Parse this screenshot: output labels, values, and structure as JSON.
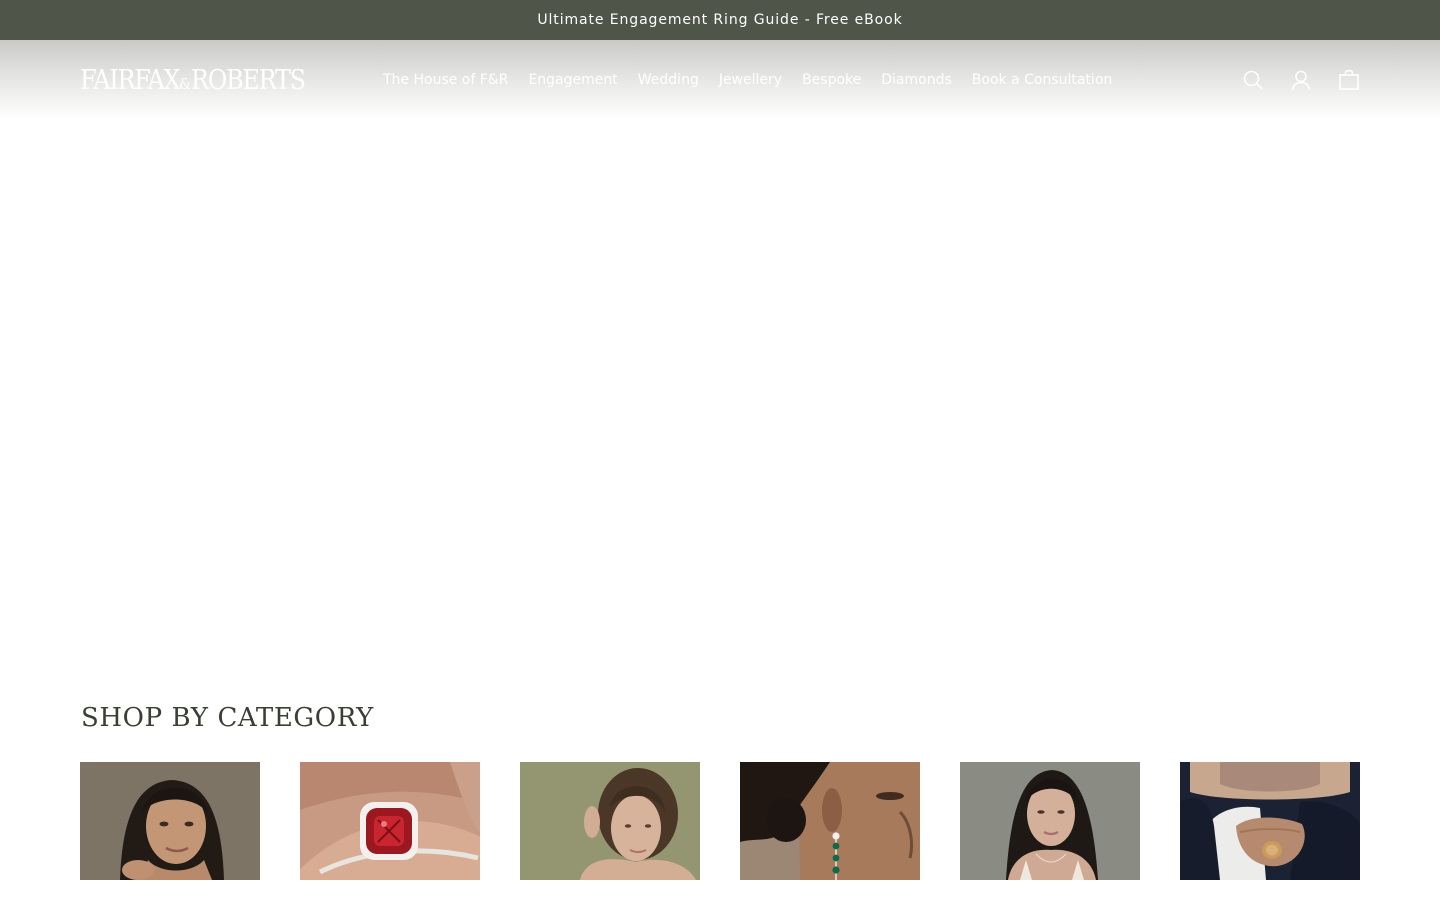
{
  "announcement": {
    "text": "Ultimate Engagement Ring Guide - Free eBook"
  },
  "header": {
    "logo_left": "FAIRFAX",
    "logo_amp": "&",
    "logo_right": "ROBERTS",
    "nav": [
      {
        "label": "The House of F&R"
      },
      {
        "label": "Engagement"
      },
      {
        "label": "Wedding"
      },
      {
        "label": "Jewellery"
      },
      {
        "label": "Bespoke"
      },
      {
        "label": "Diamonds"
      },
      {
        "label": "Book a Consultation"
      }
    ],
    "icons": [
      "search-icon",
      "account-icon",
      "bag-icon"
    ]
  },
  "section": {
    "title": "SHOP BY CATEGORY"
  },
  "categories": [
    {
      "image": "woman-portrait-image"
    },
    {
      "image": "ruby-ring-image"
    },
    {
      "image": "woman-earring-image"
    },
    {
      "image": "emerald-drop-earring-image"
    },
    {
      "image": "woman-necklace-image"
    },
    {
      "image": "mens-signet-ring-image"
    }
  ],
  "colors": {
    "announcement_bg": "#4f5549",
    "title_text": "#3a3f33"
  }
}
